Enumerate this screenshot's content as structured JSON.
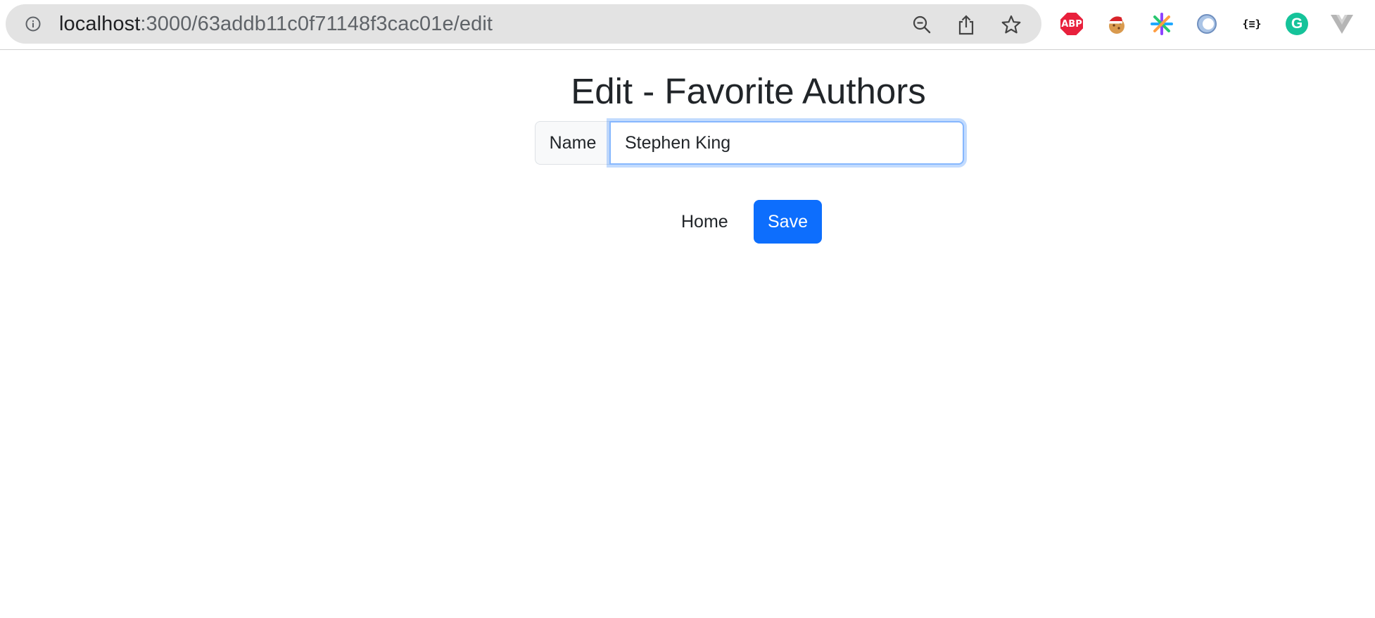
{
  "browser": {
    "url_host": "localhost",
    "url_path": ":3000/63addb11c0f71148f3cac01e/edit",
    "toolbar_icons": [
      "info-icon",
      "zoom-out-icon",
      "share-icon",
      "bookmark-star-icon"
    ],
    "extensions": [
      {
        "name": "adblock-plus-extension-icon",
        "label": "ABP",
        "color": "#e8203c"
      },
      {
        "name": "cookie-extension-icon"
      },
      {
        "name": "sparkle-extension-icon"
      },
      {
        "name": "ring-extension-icon"
      },
      {
        "name": "json-viewer-extension-icon",
        "label": "{≡}"
      },
      {
        "name": "grammarly-extension-icon",
        "label": "G",
        "color": "#15c39a"
      },
      {
        "name": "vue-devtools-extension-icon"
      }
    ]
  },
  "page": {
    "title": "Edit - Favorite Authors",
    "form": {
      "name_label": "Name",
      "name_value": "Stephen King"
    },
    "actions": {
      "home_label": "Home",
      "save_label": "Save"
    }
  },
  "colors": {
    "primary": "#0d6efd",
    "focus_border": "#86b7fe",
    "text": "#212529"
  }
}
